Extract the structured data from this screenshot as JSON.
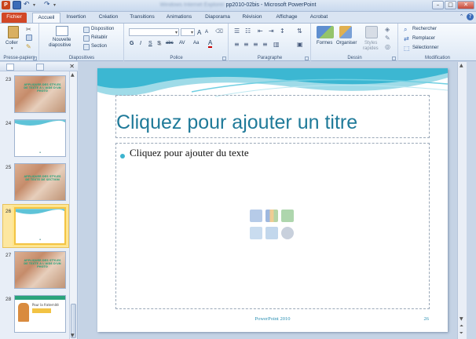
{
  "window": {
    "title": "pp2010-02bis - Microsoft PowerPoint",
    "title_blurred": "Windows Internet Explorer"
  },
  "tabs": [
    "Fichier",
    "Accueil",
    "Insertion",
    "Création",
    "Transitions",
    "Animations",
    "Diaporama",
    "Révision",
    "Affichage",
    "Acrobat"
  ],
  "active_tab": "Accueil",
  "ribbon": {
    "clipboard": {
      "label": "Presse-papiers",
      "paste": "Coller"
    },
    "slides": {
      "label": "Diapositives",
      "new_slide_line1": "Nouvelle",
      "new_slide_line2": "diapositive",
      "layout": "Disposition",
      "reset": "Rétablir",
      "section": "Section"
    },
    "font": {
      "label": "Police",
      "bold": "G",
      "italic": "I",
      "underline": "S",
      "shadow": "S",
      "strike": "abc",
      "spacing": "AV",
      "case": "Aa",
      "grow": "A",
      "shrink": "A",
      "color": "A"
    },
    "paragraph": {
      "label": "Paragraphe"
    },
    "drawing": {
      "label": "Dessin",
      "shapes": "Formes",
      "arrange": "Organiser",
      "styles_line1": "Styles",
      "styles_line2": "rapides"
    },
    "editing": {
      "label": "Modification",
      "find": "Rechercher",
      "replace": "Remplacer",
      "select": "Sélectionner"
    }
  },
  "thumbnails": [
    {
      "num": "23",
      "kind": "photo",
      "text": "APPLIQUER DES STYLES DE TEXTE A L'AIDE D'UN PHOTO"
    },
    {
      "num": "24",
      "kind": "blank",
      "text": ""
    },
    {
      "num": "25",
      "kind": "photo",
      "text": "APPLIQUER DES STYLES DE TEXTE DE SECTION"
    },
    {
      "num": "26",
      "kind": "blank",
      "text": "",
      "selected": true
    },
    {
      "num": "27",
      "kind": "photo",
      "text": "APPLIQUER DES STYLES DE TEXTE A L'AIDE D'UN PHOTO"
    },
    {
      "num": "28",
      "kind": "person",
      "text": "Pour la fraternité"
    }
  ],
  "slide": {
    "title_placeholder": "Cliquez pour ajouter un titre",
    "body_placeholder": "Cliquez pour ajouter du texte",
    "footer": "PowerPoint 2010",
    "number": "26"
  },
  "colors": {
    "accent": "#3db4cf",
    "title": "#1f7a99",
    "file_tab": "#d24726",
    "selection": "#f2c344"
  }
}
